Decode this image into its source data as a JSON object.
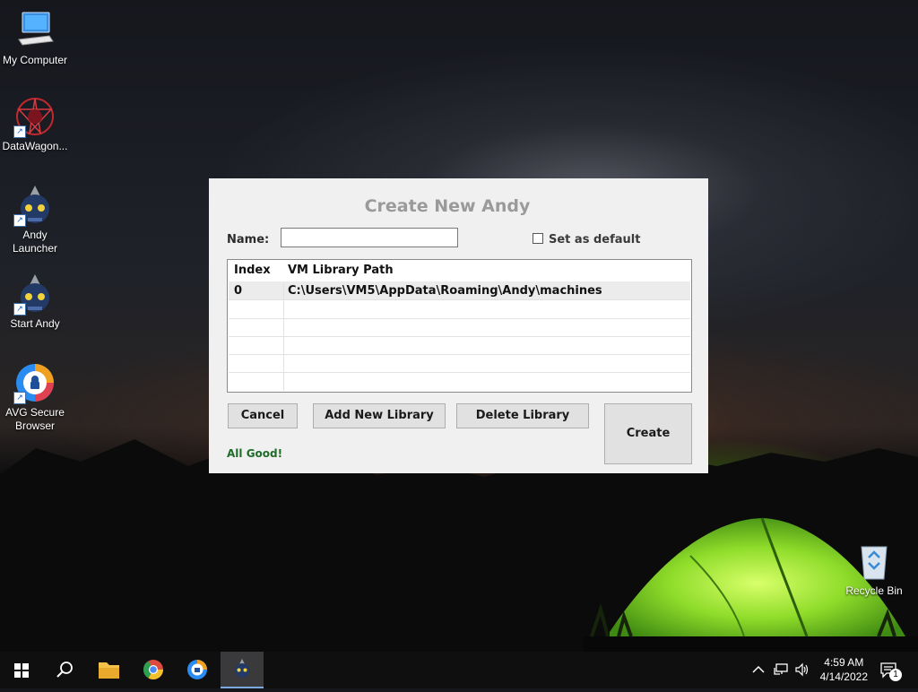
{
  "desktop": {
    "icons": [
      {
        "label": "My Computer"
      },
      {
        "label": "DataWagon..."
      },
      {
        "label": "Andy Launcher"
      },
      {
        "label": "Start Andy"
      },
      {
        "label": "AVG Secure Browser"
      },
      {
        "label": "Recycle Bin"
      }
    ]
  },
  "dialog": {
    "title": "Create New Andy",
    "name_label": "Name:",
    "name_value": "",
    "set_default_label": "Set as default",
    "table": {
      "headers": [
        "Index",
        "VM Library Path"
      ],
      "rows": [
        {
          "index": "0",
          "path": "C:\\Users\\VM5\\AppData\\Roaming\\Andy\\machines"
        }
      ]
    },
    "buttons": {
      "cancel": "Cancel",
      "add_library": "Add New Library",
      "delete_library": "Delete Library",
      "create": "Create"
    },
    "status": "All Good!"
  },
  "taskbar": {
    "time": "4:59 AM",
    "date": "4/14/2022",
    "notification_count": "1"
  },
  "colors": {
    "status_green": "#1e6b2a",
    "title_gray": "#9a9a9a",
    "taskbar": "#0f0f10"
  }
}
